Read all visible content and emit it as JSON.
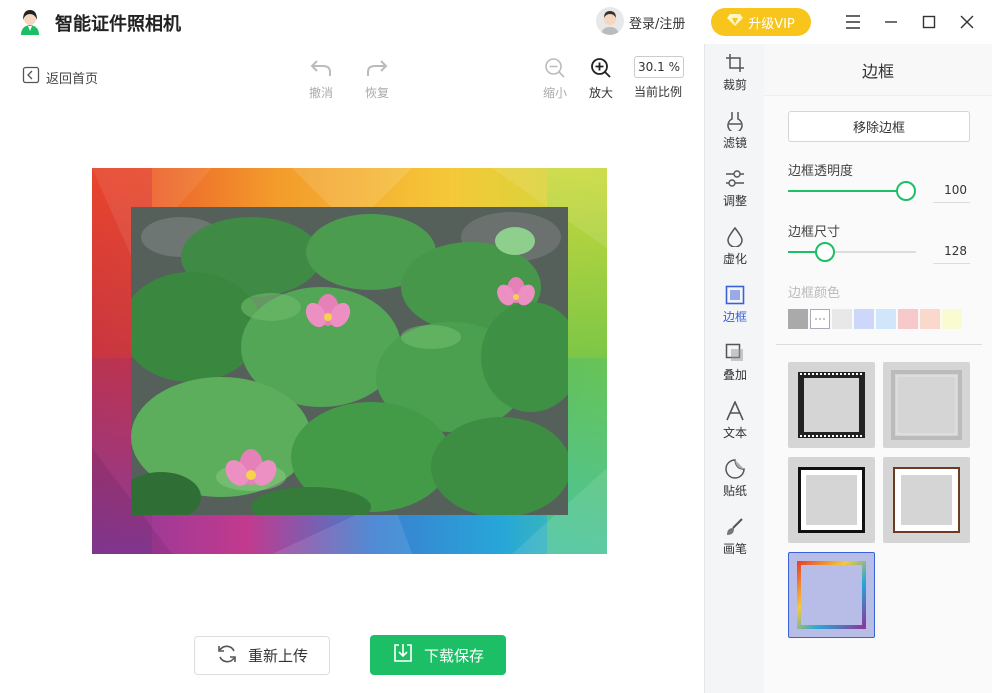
{
  "app": {
    "title": "智能证件照相机"
  },
  "user": {
    "login_label": "登录/注册"
  },
  "vip": {
    "label": "升级VIP",
    "color": "#f7c51c"
  },
  "window_controls": [
    "menu-icon",
    "minimize-icon",
    "maximize-icon",
    "close-icon"
  ],
  "toolbar": {
    "back_label": "返回首页",
    "undo_label": "撤消",
    "redo_label": "恢复",
    "zoom_out_label": "缩小",
    "zoom_in_label": "放大",
    "zoom_value": "30.1 %",
    "zoom_caption": "当前比例"
  },
  "actions": {
    "reupload_label": "重新上传",
    "download_label": "下载保存",
    "accent_color": "#1dbf66"
  },
  "side_tools": [
    {
      "label": "裁剪",
      "icon": "crop-icon",
      "active": false
    },
    {
      "label": "滤镜",
      "icon": "filter-icon",
      "active": false
    },
    {
      "label": "调整",
      "icon": "adjust-icon",
      "active": false
    },
    {
      "label": "虚化",
      "icon": "blur-icon",
      "active": false
    },
    {
      "label": "边框",
      "icon": "border-icon",
      "active": true
    },
    {
      "label": "叠加",
      "icon": "overlay-icon",
      "active": false
    },
    {
      "label": "文本",
      "icon": "text-icon",
      "active": false
    },
    {
      "label": "贴纸",
      "icon": "sticker-icon",
      "active": false
    },
    {
      "label": "画笔",
      "icon": "brush-icon",
      "active": false
    }
  ],
  "panel": {
    "title": "边框",
    "remove_label": "移除边框",
    "opacity_label": "边框透明度",
    "opacity_value": "100",
    "opacity_level": 1.0,
    "size_label": "边框尺寸",
    "size_value": "128",
    "size_level": 0.25,
    "color_label": "边框颜色",
    "colors": [
      "#aaaaaa",
      "#ffffff",
      "#e8e8e8",
      "#cdd6fb",
      "#cfe6fb",
      "#f7c9cb",
      "#fbd8cc",
      "#fafbd1"
    ],
    "frames": [
      "film-frame",
      "silver-frame",
      "black-frame",
      "wood-frame",
      "gradient-frame"
    ],
    "selected_frame": "gradient-frame",
    "active_color": "#3b62d6"
  }
}
